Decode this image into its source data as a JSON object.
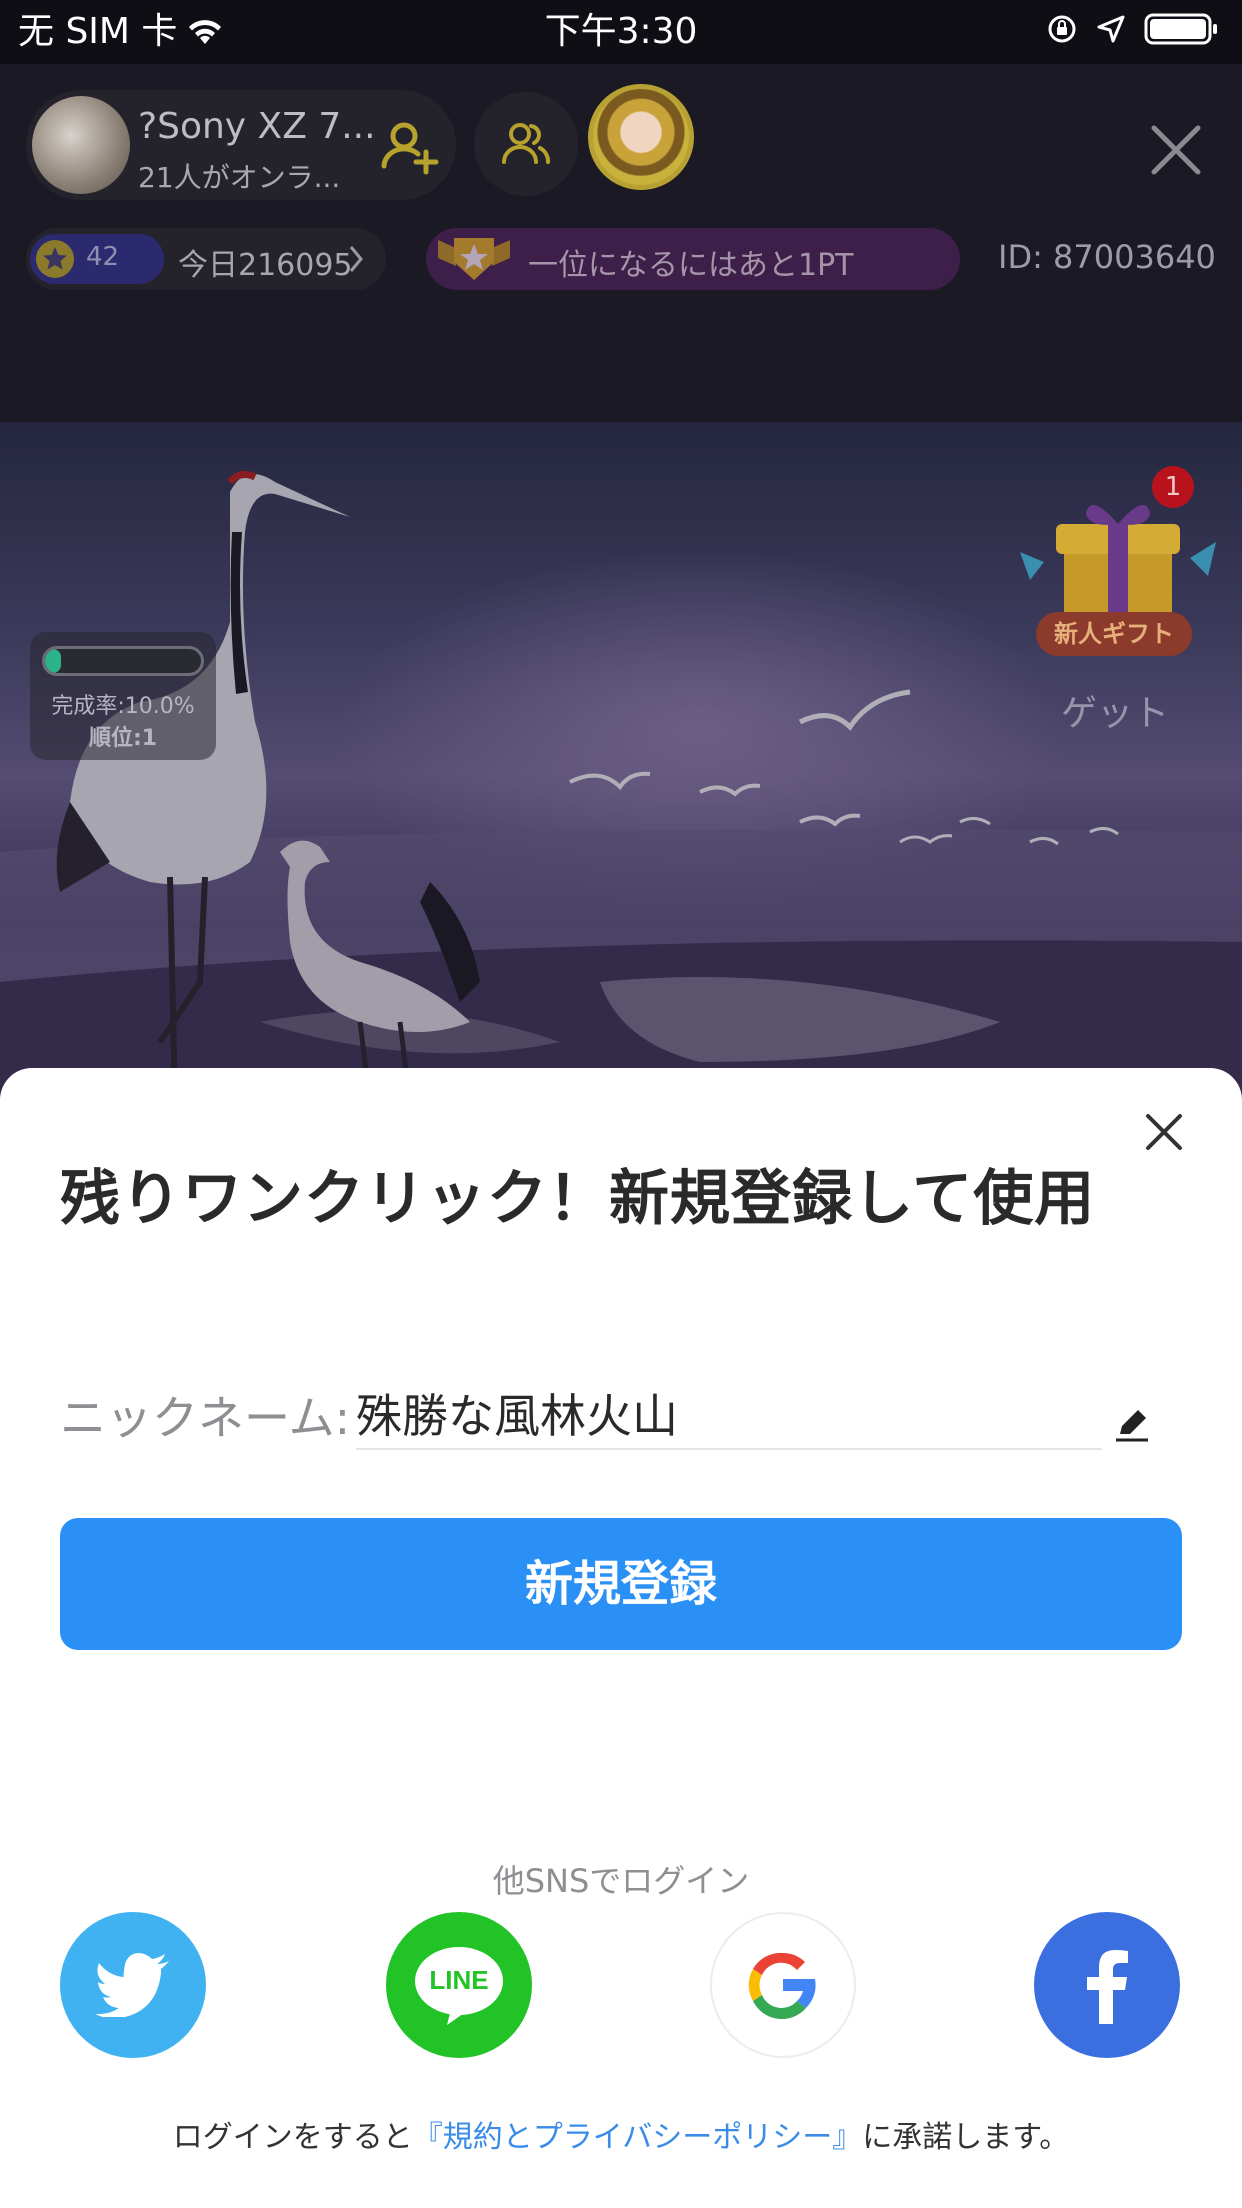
{
  "status_bar": {
    "carrier": "无 SIM 卡",
    "time": "下午3:30",
    "icons": [
      "wifi-icon",
      "rotation-lock-icon",
      "location-icon",
      "battery-icon"
    ]
  },
  "header": {
    "streamer_name": "?Sony XZ 7...",
    "streamer_sub": "21人がオンラ...",
    "level": "42",
    "today": "今日216095",
    "rank_message": "一位になるにはあと1PT",
    "room_id": "ID: 87003640"
  },
  "scene": {
    "progress_fraction": 0.1,
    "completion_label": "完成率:10.0%",
    "rank_label": "順位:1",
    "gift_badge_count": "1",
    "gift_label": "新人ギフト",
    "gift_get": "ゲット"
  },
  "sheet": {
    "title": "残りワンクリック！新規登録して使用",
    "nickname_label": "ニックネーム:",
    "nickname_value": "殊勝な風林火山",
    "register_label": "新規登録",
    "sns_label": "他SNSでログイン",
    "sns_line_text": "LINE",
    "terms_prefix": "ログインをすると",
    "terms_link": "『規約とプライバシーポリシー』",
    "terms_suffix": "に承諾します。"
  },
  "colors": {
    "primary": "#2b90f5",
    "twitter": "#40b2f2",
    "line": "#22c327",
    "facebook": "#3b6fe0",
    "link": "#3a8ce8",
    "progress": "#2db38a"
  }
}
